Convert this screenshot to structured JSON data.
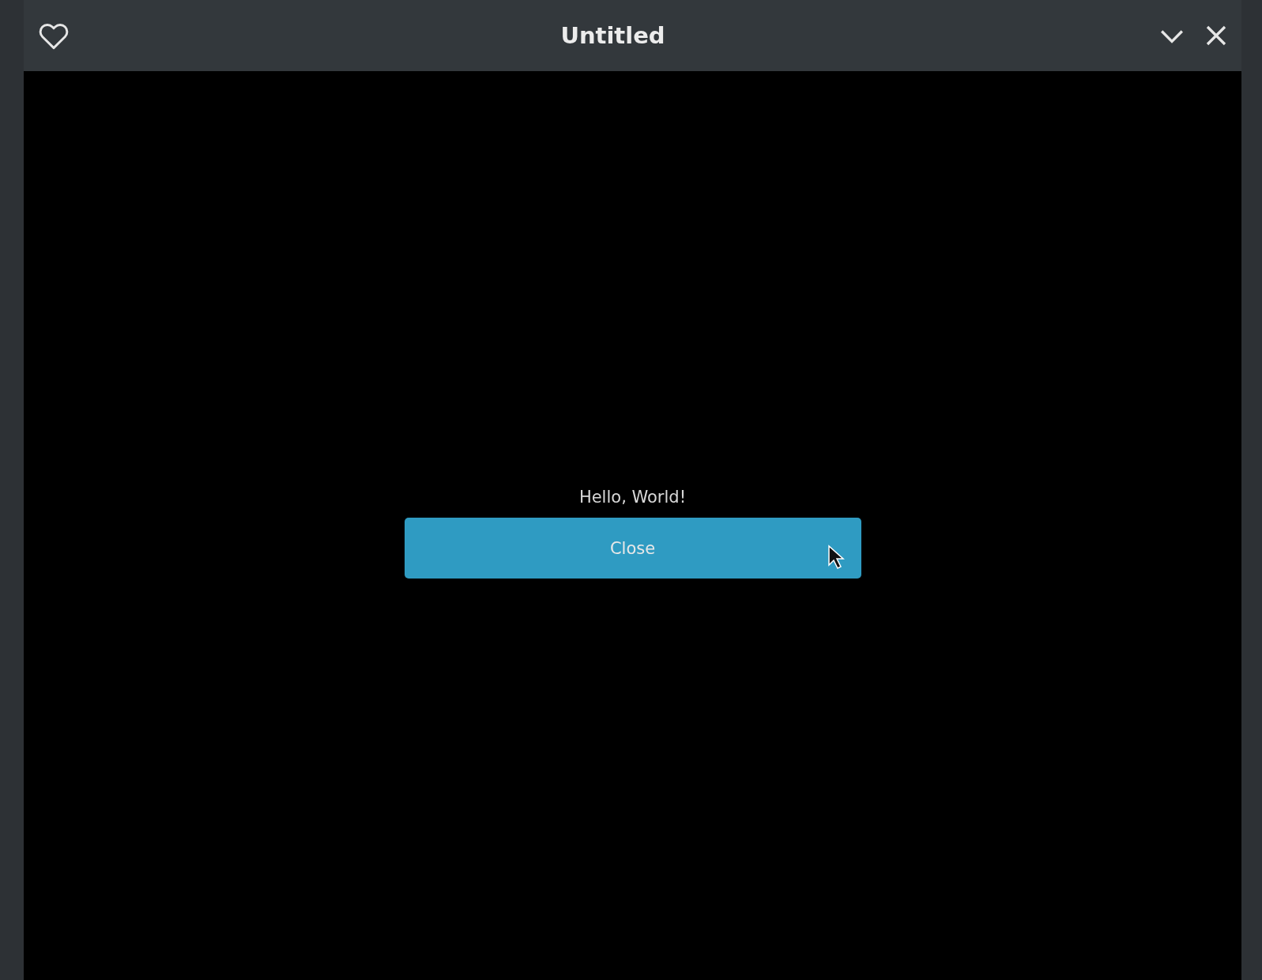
{
  "window": {
    "title": "Untitled"
  },
  "content": {
    "message": "Hello, World!",
    "button": {
      "label": "Close",
      "hovered": true
    }
  }
}
